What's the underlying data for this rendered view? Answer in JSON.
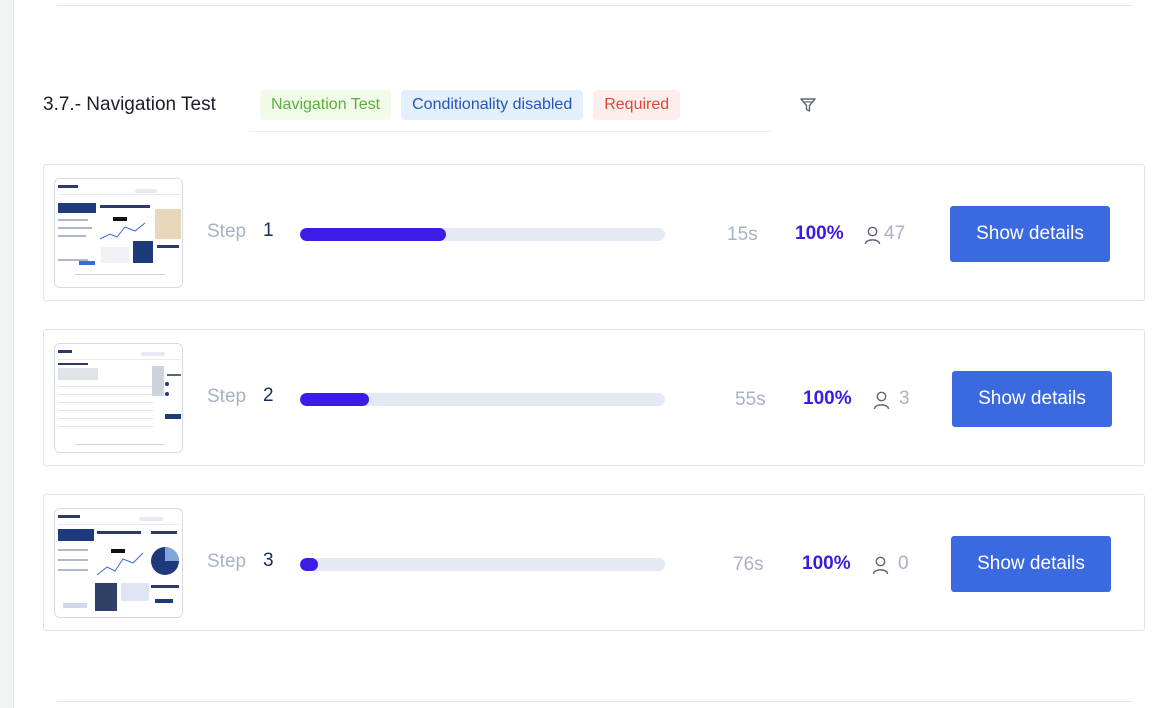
{
  "section": {
    "title": "3.7.- Navigation Test",
    "tags": [
      {
        "label": "Navigation Test",
        "color": "#58b03a"
      },
      {
        "label": "Conditionality disabled",
        "color": "#2554b7"
      },
      {
        "label": "Required",
        "color": "#e0463a"
      }
    ],
    "filter_icon": "funnel-icon"
  },
  "steps": [
    {
      "label": "Step",
      "number": "1",
      "progress_fraction": 0.4,
      "time": "15s",
      "percent": "100%",
      "users": "47",
      "button_label": "Show details"
    },
    {
      "label": "Step",
      "number": "2",
      "progress_fraction": 0.19,
      "time": "55s",
      "percent": "100%",
      "users": "3",
      "button_label": "Show details"
    },
    {
      "label": "Step",
      "number": "3",
      "progress_fraction": 0.05,
      "time": "76s",
      "percent": "100%",
      "users": "0",
      "button_label": "Show details"
    }
  ],
  "colors": {
    "progress_fill": "#3d1ae6",
    "button": "#3b6ae0",
    "percent_text": "#3a1be0"
  }
}
